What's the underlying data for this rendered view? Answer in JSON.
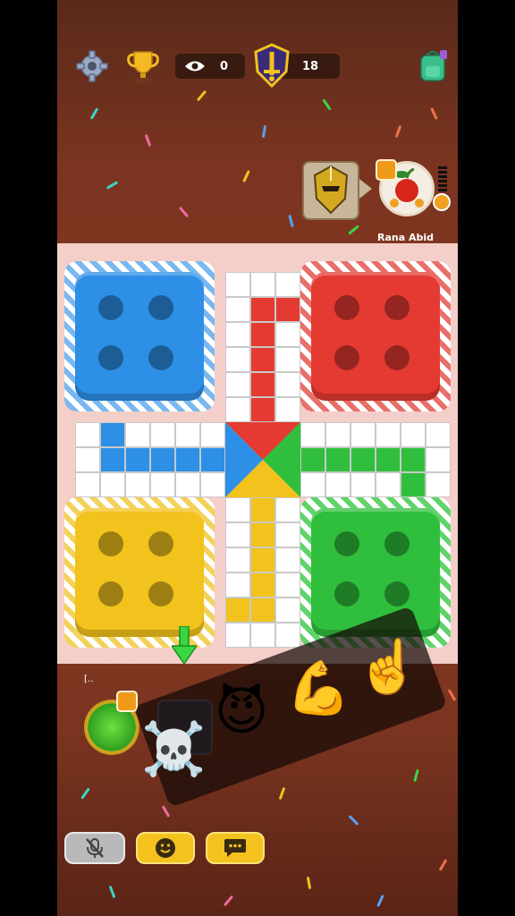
{
  "header": {
    "settings_icon": "gear-icon",
    "trophy_icon": "trophy-icon",
    "spectators_icon": "eye-icon",
    "spectators_count": "0",
    "rank_icon": "sword-shield-icon",
    "rank_value": "18",
    "shop_icon": "backpack-icon"
  },
  "players": {
    "top_right": {
      "name": "Rana Abid",
      "avatar_icon": "apple-avatar",
      "frame_icon": "knight-helmet-frame"
    },
    "bottom_left": {
      "name": "[..",
      "avatar_icon": "green-avatar"
    }
  },
  "board": {
    "colors": {
      "blue": "#2d8fe6",
      "red": "#e43a32",
      "yellow": "#f2c21d",
      "green": "#2fbf3c",
      "cell": "#ffffff"
    },
    "homes": [
      "blue",
      "red",
      "yellow",
      "green"
    ]
  },
  "emoji_panel": {
    "items": [
      "skull-crossbones",
      "smiling-devil",
      "flexed-biceps",
      "pointing-up-hand"
    ]
  },
  "bottom_bar": {
    "mute_icon": "mic-off-icon",
    "emoji_icon": "smiley-icon",
    "chat_icon": "chat-icon"
  },
  "turn_indicator_icon": "down-arrow-icon"
}
